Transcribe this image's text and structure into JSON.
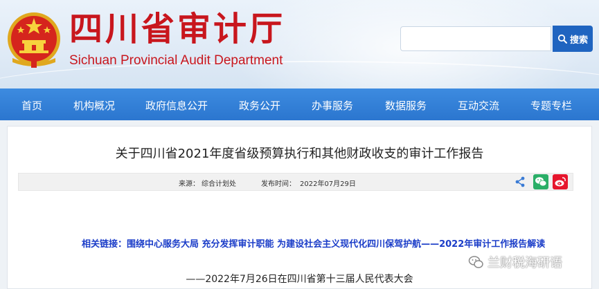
{
  "header": {
    "site_title": "四川省审计厅",
    "site_subtitle": "Sichuan Provincial Audit Department",
    "search": {
      "placeholder": "",
      "button_label": "搜索"
    }
  },
  "nav": {
    "items": [
      {
        "label": "首页"
      },
      {
        "label": "机构概况"
      },
      {
        "label": "政府信息公开"
      },
      {
        "label": "政务公开"
      },
      {
        "label": "办事服务"
      },
      {
        "label": "数据服务"
      },
      {
        "label": "互动交流"
      },
      {
        "label": "专题专栏"
      }
    ]
  },
  "article": {
    "title": "关于四川省2021年度省级预算执行和其他财政收支的审计工作报告",
    "source_label": "来源：",
    "source_value": "综合计划处",
    "date_label": "发布时间：",
    "date_value": "2022年07月29日",
    "related_label": "相关链接：",
    "related_link": "围绕中心服务大局  充分发挥审计职能  为建设社会主义现代化四川保驾护航——2022年审计工作报告解读",
    "subline": "——2022年7月26日在四川省第十三届人民代表大会"
  },
  "watermark": {
    "text": "兰财税海研语"
  },
  "colors": {
    "brand_red": "#c8161d",
    "nav_blue": "#2b76cf",
    "search_blue": "#1f64c0",
    "link_blue": "#1a3cc8",
    "wechat_green": "#2aae67",
    "weibo_red": "#e6162d"
  }
}
